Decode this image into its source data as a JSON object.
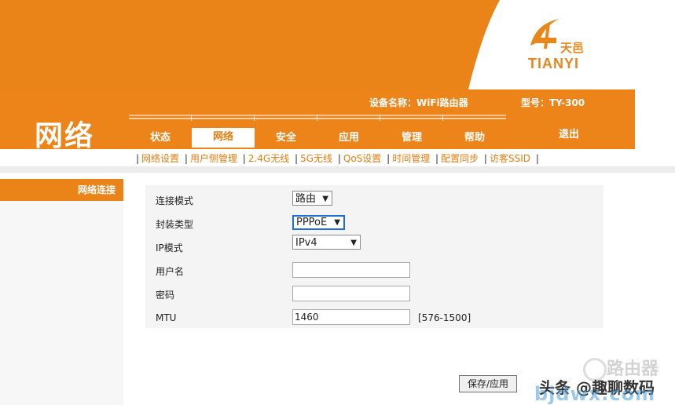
{
  "header": {
    "section_title": "网络",
    "device_name": "设备名称：WiFi路由器",
    "model": "型号：TY-300",
    "logout": "退出",
    "logo_cn": "天邑",
    "logo_en": "TIANYI"
  },
  "tabs": [
    {
      "label": "状态",
      "active": false
    },
    {
      "label": "网络",
      "active": true
    },
    {
      "label": "安全",
      "active": false
    },
    {
      "label": "应用",
      "active": false
    },
    {
      "label": "管理",
      "active": false
    },
    {
      "label": "帮助",
      "active": false
    }
  ],
  "subnav": [
    "网络设置",
    "用户侧管理",
    "2.4G无线",
    "5G无线",
    "QoS设置",
    "时间管理",
    "配置同步",
    "访客SSID"
  ],
  "left_menu": {
    "item": "网络连接"
  },
  "form": {
    "connection_mode_label": "连接模式",
    "connection_mode_value": "路由",
    "encapsulation_label": "封装类型",
    "encapsulation_value": "PPPoE",
    "ip_mode_label": "IP模式",
    "ip_mode_value": "IPv4",
    "username_label": "用户名",
    "username_value": "",
    "password_label": "密码",
    "password_value": "",
    "mtu_label": "MTU",
    "mtu_value": "1460",
    "mtu_range": "[576-1500]",
    "save_label": "保存/应用"
  },
  "watermark": {
    "text1": "头条 @趣聊数码",
    "text2": "路由器",
    "text3": "bjdwx.com"
  },
  "colors": {
    "brand_orange": "#ea8318",
    "logo_orange": "#e8861a",
    "link_orange": "#e47d12",
    "focus_blue": "#1f6fd8"
  }
}
